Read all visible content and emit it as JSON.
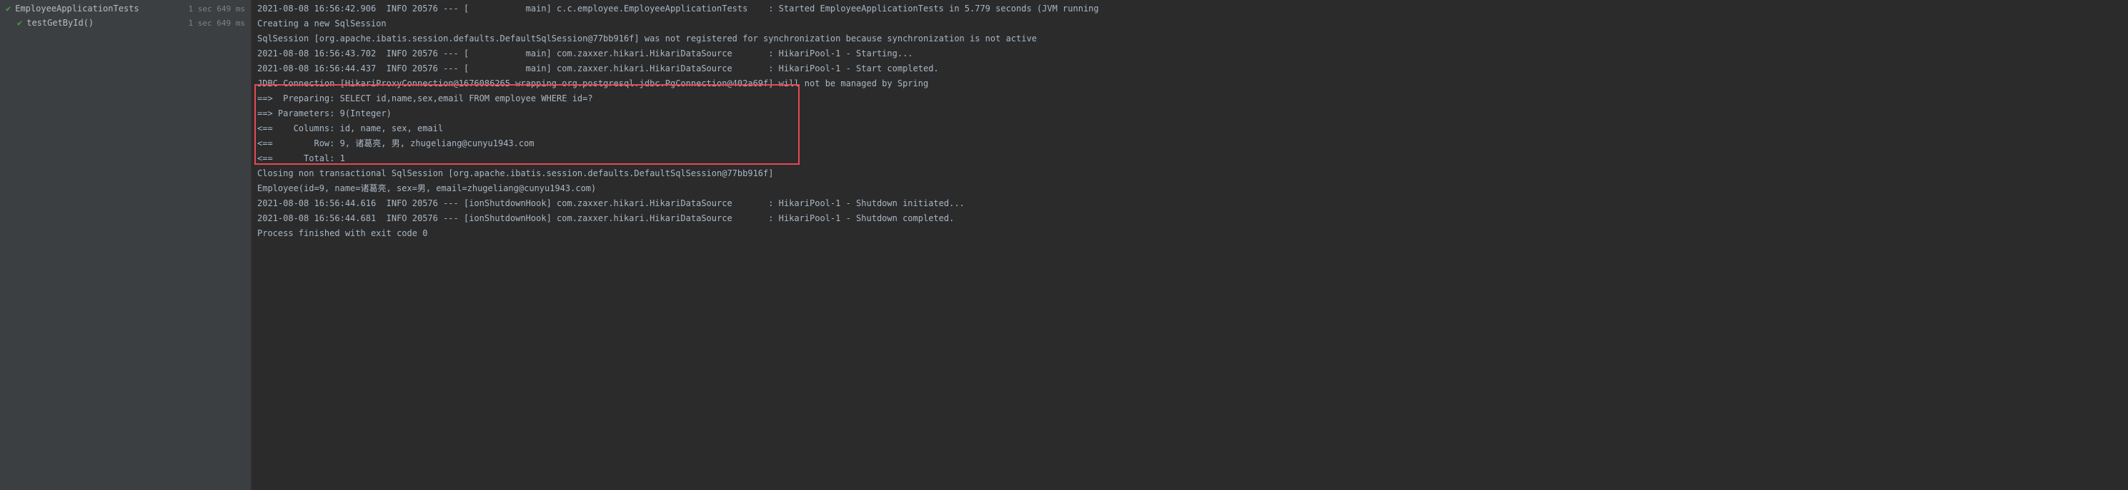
{
  "tests": {
    "root": {
      "name": "EmployeeApplicationTests",
      "time_sec": "1 sec",
      "time_ms": "649 ms"
    },
    "child": {
      "name": "testGetById()",
      "time_sec": "1 sec",
      "time_ms": "649 ms"
    }
  },
  "console": {
    "line1": "2021-08-08 16:56:42.906  INFO 20576 --- [           main] c.c.employee.EmployeeApplicationTests    : Started EmployeeApplicationTests in 5.779 seconds (JVM running",
    "line2": "Creating a new SqlSession",
    "line3": "SqlSession [org.apache.ibatis.session.defaults.DefaultSqlSession@77bb916f] was not registered for synchronization because synchronization is not active",
    "line4": "2021-08-08 16:56:43.702  INFO 20576 --- [           main] com.zaxxer.hikari.HikariDataSource       : HikariPool-1 - Starting...",
    "line5": "2021-08-08 16:56:44.437  INFO 20576 --- [           main] com.zaxxer.hikari.HikariDataSource       : HikariPool-1 - Start completed.",
    "line6": "JDBC Connection [HikariProxyConnection@1676086265 wrapping org.postgresql.jdbc.PgConnection@402a69f] will not be managed by Spring",
    "line7": "==>  Preparing: SELECT id,name,sex,email FROM employee WHERE id=?",
    "line8": "==> Parameters: 9(Integer)",
    "line9": "<==    Columns: id, name, sex, email",
    "line10": "<==        Row: 9, 诸葛亮, 男, zhugeliang@cunyu1943.com",
    "line11": "<==      Total: 1",
    "line12": "Closing non transactional SqlSession [org.apache.ibatis.session.defaults.DefaultSqlSession@77bb916f]",
    "line13": "Employee(id=9, name=诸葛亮, sex=男, email=zhugeliang@cunyu1943.com)",
    "line14": "2021-08-08 16:56:44.616  INFO 20576 --- [ionShutdownHook] com.zaxxer.hikari.HikariDataSource       : HikariPool-1 - Shutdown initiated...",
    "line15": "2021-08-08 16:56:44.681  INFO 20576 --- [ionShutdownHook] com.zaxxer.hikari.HikariDataSource       : HikariPool-1 - Shutdown completed.",
    "line16": "",
    "line17": "Process finished with exit code 0"
  }
}
